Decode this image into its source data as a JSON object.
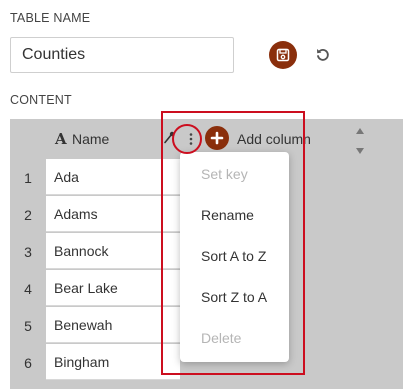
{
  "table_name_section": {
    "label": "TABLE NAME",
    "input_value": "Counties",
    "save_icon": "floppy-disk-icon",
    "undo_icon": "undo-icon"
  },
  "content_section": {
    "label": "CONTENT"
  },
  "grid": {
    "column": {
      "type_icon_glyph": "A",
      "name": "Name",
      "key_icon": "key-icon",
      "menu_icon": "more-vertical-icon"
    },
    "add_column_label": "Add column",
    "add_column_icon": "plus-icon",
    "rows": [
      {
        "num": "1",
        "value": "Ada"
      },
      {
        "num": "2",
        "value": "Adams"
      },
      {
        "num": "3",
        "value": "Bannock"
      },
      {
        "num": "4",
        "value": "Bear Lake"
      },
      {
        "num": "5",
        "value": "Benewah"
      },
      {
        "num": "6",
        "value": "Bingham"
      }
    ]
  },
  "column_menu": {
    "items": [
      {
        "label": "Set key",
        "disabled": true
      },
      {
        "label": "Rename",
        "disabled": false
      },
      {
        "label": "Sort A to Z",
        "disabled": false
      },
      {
        "label": "Sort Z to A",
        "disabled": false
      },
      {
        "label": "Delete",
        "disabled": true
      }
    ]
  },
  "colors": {
    "accent": "#8a2f0c",
    "highlight": "#cc0e1f",
    "grid_bg": "#c9c9c9"
  }
}
